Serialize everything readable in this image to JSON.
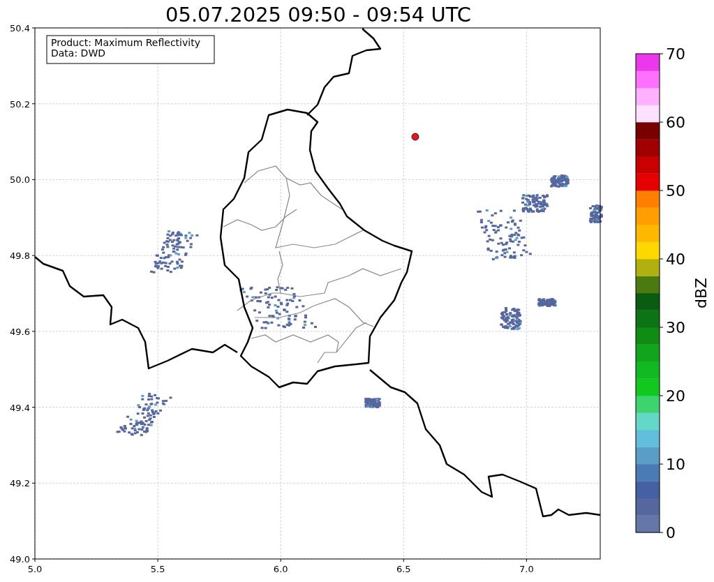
{
  "title": "05.07.2025 09:50 - 09:54 UTC",
  "info_box": {
    "lines": [
      "Product: Maximum Reflectivity",
      "Data: DWD"
    ]
  },
  "map": {
    "x_ticks": [
      "5.0",
      "5.5",
      "6.0",
      "6.5",
      "7.0"
    ],
    "y_ticks": [
      "50.4",
      "50.2",
      "50.0",
      "49.8",
      "49.6",
      "49.4",
      "49.2",
      "49.0"
    ]
  },
  "colorbar": {
    "label": "dBZ",
    "ticks": [
      "70",
      "60",
      "50",
      "40",
      "30",
      "20",
      "10",
      "0"
    ],
    "bands": [
      {
        "color": "#6577a8"
      },
      {
        "color": "#5667a0"
      },
      {
        "color": "#4361a3"
      },
      {
        "color": "#4a7bb5"
      },
      {
        "color": "#5a9ec8"
      },
      {
        "color": "#62bedd"
      },
      {
        "color": "#64d8c8"
      },
      {
        "color": "#3dd470"
      },
      {
        "color": "#12c81f"
      },
      {
        "color": "#12b81f"
      },
      {
        "color": "#10a51c"
      },
      {
        "color": "#0e8c14"
      },
      {
        "color": "#0c7414"
      },
      {
        "color": "#0a5c10"
      },
      {
        "color": "#4a7a10"
      },
      {
        "color": "#b0b010"
      },
      {
        "color": "#ffd800"
      },
      {
        "color": "#ffb800"
      },
      {
        "color": "#ff9e00"
      },
      {
        "color": "#ff7f00"
      },
      {
        "color": "#e60000"
      },
      {
        "color": "#c80000"
      },
      {
        "color": "#a00000"
      },
      {
        "color": "#780000"
      },
      {
        "color": "#ffe0ff"
      },
      {
        "color": "#ffb0ff"
      },
      {
        "color": "#ff70ff"
      },
      {
        "color": "#ec38ec"
      }
    ]
  }
}
